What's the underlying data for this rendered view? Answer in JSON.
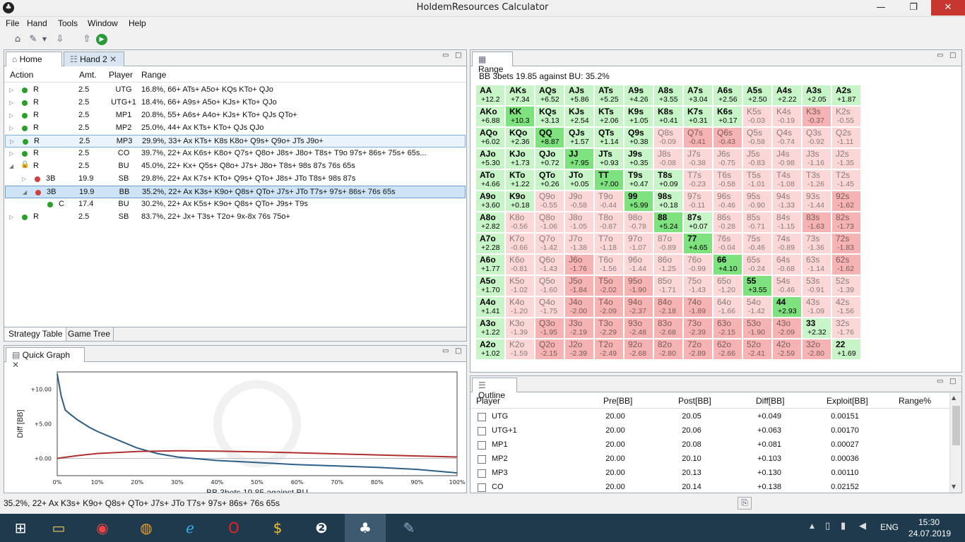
{
  "window": {
    "title": "HoldemResources Calculator",
    "icon": "club-icon",
    "min": "—",
    "max": "❐",
    "close": "✕"
  },
  "menu": [
    "File",
    "Hand",
    "Tools",
    "Window",
    "Help"
  ],
  "tabs": {
    "home": "Home",
    "hand": "Hand 2"
  },
  "tree": {
    "headers": {
      "action": "Action",
      "amt": "Amt.",
      "player": "Player",
      "range": "Range"
    },
    "rows": [
      {
        "action": "R",
        "amt": "2.5",
        "player": "UTG",
        "range": "16.8%, 66+ ATs+ A5o+ KQs KTo+ QJo"
      },
      {
        "action": "R",
        "amt": "2.5",
        "player": "UTG+1",
        "range": "18.4%, 66+ A9s+ A5o+ KJs+ KTo+ QJo"
      },
      {
        "action": "R",
        "amt": "2.5",
        "player": "MP1",
        "range": "20.8%, 55+ A6s+ A4o+ KJs+ KTo+ QJs QTo+"
      },
      {
        "action": "R",
        "amt": "2.5",
        "player": "MP2",
        "range": "25.0%, 44+ Ax KTs+ KTo+ QJs QJo"
      },
      {
        "action": "R",
        "amt": "2.5",
        "player": "MP3",
        "range": "29.9%, 33+ Ax KTs+ K8s K8o+ Q9s+ Q9o+ JTs J9o+"
      },
      {
        "action": "R",
        "amt": "2.5",
        "player": "CO",
        "range": "39.7%, 22+ Ax K6s+ K8o+ Q7s+ Q8o+ J8s+ J8o+ T8s+ T9o 97s+ 86s+ 75s+ 65s..."
      },
      {
        "action": "R",
        "amt": "2.5",
        "player": "BU",
        "range": "45.0%, 22+ Kx+ Q5s+ Q8o+ J7s+ J8o+ T8s+ 98s 87s 76s 65s"
      },
      {
        "action": "3B",
        "amt": "19.9",
        "player": "SB",
        "range": "29.8%, 22+ Ax K7s+ KTo+ Q9s+ QTo+ J8s+ JTo T8s+ 98s 87s"
      },
      {
        "action": "3B",
        "amt": "19.9",
        "player": "BB",
        "range": "35.2%, 22+ Ax K3s+ K9o+ Q8s+ QTo+ J7s+ JTo T7s+ 97s+ 86s+ 76s 65s"
      },
      {
        "action": "C",
        "amt": "17.4",
        "player": "BU",
        "range": "30.2%, 22+ Ax K5s+ K9o+ Q8s+ QTo+ J9s+ T9s"
      },
      {
        "action": "R",
        "amt": "2.5",
        "player": "SB",
        "range": "83.7%, 22+ Jx+ T3s+ T2o+ 9x-8x 76s 75o+"
      }
    ],
    "bottom_tabs": [
      "Strategy Table",
      "Game Tree"
    ]
  },
  "quick_graph": {
    "title": "Quick Graph",
    "ylabel": "Diff [BB]",
    "xlabel": "BB 3bets 19.85 against BU",
    "yticks": [
      "+10.00",
      "+5.00",
      "+0.00"
    ],
    "xticks": [
      "0%",
      "10%",
      "20%",
      "30%",
      "40%",
      "50%",
      "60%",
      "70%",
      "80%",
      "90%",
      "100%"
    ]
  },
  "chart_data": {
    "type": "line",
    "title": "",
    "xlabel": "BB 3bets 19.85 against BU",
    "ylabel": "Diff [BB]",
    "xlim": [
      0,
      100
    ],
    "ylim": [
      -2.5,
      12.5
    ],
    "series": [
      {
        "color": "#2e5f86",
        "x": [
          0,
          1,
          2,
          3,
          5,
          8,
          10,
          15,
          20,
          25,
          30,
          40,
          50,
          60,
          70,
          80,
          90,
          100
        ],
        "y": [
          12.2,
          9,
          7,
          6.5,
          5.6,
          4.5,
          3.9,
          2.7,
          1.5,
          0.7,
          0.2,
          -0.3,
          -0.6,
          -0.9,
          -1.1,
          -1.3,
          -1.6,
          -2.1
        ]
      },
      {
        "color": "#b03030",
        "x": [
          0,
          5,
          10,
          20,
          30,
          40,
          50,
          60,
          70,
          80,
          90,
          100
        ],
        "y": [
          0,
          0.4,
          0.7,
          1.0,
          1.1,
          1.05,
          0.95,
          0.8,
          0.65,
          0.5,
          0.35,
          0.2
        ]
      }
    ]
  },
  "range": {
    "title": "Range",
    "subtitle": "BB 3bets 19.85 against BU: 35.2%",
    "colors": {
      "green_strong": "#7ee27e",
      "green_light": "#c8f5c8",
      "red_light": "#fbd7d7",
      "red_mid": "#f6b3b3"
    },
    "rows": [
      [
        [
          "AA",
          "+12.2",
          "g"
        ],
        [
          "AKs",
          "+7.34",
          "g"
        ],
        [
          "AQs",
          "+6.52",
          "g"
        ],
        [
          "AJs",
          "+5.86",
          "g"
        ],
        [
          "ATs",
          "+5.25",
          "g"
        ],
        [
          "A9s",
          "+4.26",
          "g"
        ],
        [
          "A8s",
          "+3.55",
          "g"
        ],
        [
          "A7s",
          "+3.04",
          "g"
        ],
        [
          "A6s",
          "+2.56",
          "g"
        ],
        [
          "A5s",
          "+2.50",
          "g"
        ],
        [
          "A4s",
          "+2.22",
          "g"
        ],
        [
          "A3s",
          "+2.05",
          "g"
        ],
        [
          "A2s",
          "+1.87",
          "g"
        ]
      ],
      [
        [
          "AKo",
          "+6.88",
          "g"
        ],
        [
          "KK",
          "+10.3",
          "G"
        ],
        [
          "KQs",
          "+3.13",
          "g"
        ],
        [
          "KJs",
          "+2.54",
          "g"
        ],
        [
          "KTs",
          "+2.06",
          "g"
        ],
        [
          "K9s",
          "+1.05",
          "g"
        ],
        [
          "K8s",
          "+0.41",
          "g"
        ],
        [
          "K7s",
          "+0.31",
          "g"
        ],
        [
          "K6s",
          "+0.17",
          "g"
        ],
        [
          "K5s",
          "-0.03",
          "r"
        ],
        [
          "K4s",
          "-0.19",
          "r"
        ],
        [
          "K3s",
          "-0.37",
          "R"
        ],
        [
          "K2s",
          "-0.55",
          "r"
        ]
      ],
      [
        [
          "AQo",
          "+6.02",
          "g"
        ],
        [
          "KQo",
          "+2.36",
          "g"
        ],
        [
          "QQ",
          "+8.87",
          "G"
        ],
        [
          "QJs",
          "+1.57",
          "g"
        ],
        [
          "QTs",
          "+1.14",
          "g"
        ],
        [
          "Q9s",
          "+0.38",
          "g"
        ],
        [
          "Q8s",
          "-0.09",
          "r"
        ],
        [
          "Q7s",
          "-0.41",
          "R"
        ],
        [
          "Q6s",
          "-0.43",
          "R"
        ],
        [
          "Q5s",
          "-0.58",
          "r"
        ],
        [
          "Q4s",
          "-0.74",
          "r"
        ],
        [
          "Q3s",
          "-0.92",
          "r"
        ],
        [
          "Q2s",
          "-1.11",
          "r"
        ]
      ],
      [
        [
          "AJo",
          "+5.30",
          "g"
        ],
        [
          "KJo",
          "+1.73",
          "g"
        ],
        [
          "QJo",
          "+0.72",
          "g"
        ],
        [
          "JJ",
          "+7.95",
          "G"
        ],
        [
          "JTs",
          "+0.93",
          "g"
        ],
        [
          "J9s",
          "+0.35",
          "g"
        ],
        [
          "J8s",
          "-0.08",
          "r"
        ],
        [
          "J7s",
          "-0.38",
          "r"
        ],
        [
          "J6s",
          "-0.75",
          "r"
        ],
        [
          "J5s",
          "-0.83",
          "r"
        ],
        [
          "J4s",
          "-0.98",
          "r"
        ],
        [
          "J3s",
          "-1.16",
          "r"
        ],
        [
          "J2s",
          "-1.35",
          "r"
        ]
      ],
      [
        [
          "ATo",
          "+4.66",
          "g"
        ],
        [
          "KTo",
          "+1.22",
          "g"
        ],
        [
          "QTo",
          "+0.26",
          "g"
        ],
        [
          "JTo",
          "+0.05",
          "g"
        ],
        [
          "TT",
          "+7.00",
          "G"
        ],
        [
          "T9s",
          "+0.47",
          "g"
        ],
        [
          "T8s",
          "+0.09",
          "g"
        ],
        [
          "T7s",
          "-0.23",
          "r"
        ],
        [
          "T6s",
          "-0.58",
          "r"
        ],
        [
          "T5s",
          "-1.01",
          "r"
        ],
        [
          "T4s",
          "-1.08",
          "r"
        ],
        [
          "T3s",
          "-1.26",
          "r"
        ],
        [
          "T2s",
          "-1.45",
          "r"
        ]
      ],
      [
        [
          "A9o",
          "+3.60",
          "g"
        ],
        [
          "K9o",
          "+0.18",
          "g"
        ],
        [
          "Q9o",
          "-0.55",
          "r"
        ],
        [
          "J9o",
          "-0.58",
          "r"
        ],
        [
          "T9o",
          "-0.44",
          "r"
        ],
        [
          "99",
          "+5.99",
          "G"
        ],
        [
          "98s",
          "+0.18",
          "g"
        ],
        [
          "97s",
          "-0.11",
          "r"
        ],
        [
          "96s",
          "-0.46",
          "r"
        ],
        [
          "95s",
          "-0.90",
          "r"
        ],
        [
          "94s",
          "-1.33",
          "r"
        ],
        [
          "93s",
          "-1.44",
          "r"
        ],
        [
          "92s",
          "-1.62",
          "R"
        ]
      ],
      [
        [
          "A8o",
          "+2.82",
          "g"
        ],
        [
          "K8o",
          "-0.56",
          "r"
        ],
        [
          "Q8o",
          "-1.06",
          "r"
        ],
        [
          "J8o",
          "-1.05",
          "r"
        ],
        [
          "T8o",
          "-0.87",
          "r"
        ],
        [
          "98o",
          "-0.78",
          "r"
        ],
        [
          "88",
          "+5.24",
          "G"
        ],
        [
          "87s",
          "+0.07",
          "g"
        ],
        [
          "86s",
          "-0.28",
          "r"
        ],
        [
          "85s",
          "-0.71",
          "r"
        ],
        [
          "84s",
          "-1.15",
          "r"
        ],
        [
          "83s",
          "-1.63",
          "R"
        ],
        [
          "82s",
          "-1.73",
          "R"
        ]
      ],
      [
        [
          "A7o",
          "+2.28",
          "g"
        ],
        [
          "K7o",
          "-0.66",
          "r"
        ],
        [
          "Q7o",
          "-1.42",
          "r"
        ],
        [
          "J7o",
          "-1.38",
          "r"
        ],
        [
          "T7o",
          "-1.18",
          "r"
        ],
        [
          "97o",
          "-1.07",
          "r"
        ],
        [
          "87o",
          "-0.89",
          "r"
        ],
        [
          "77",
          "+4.65",
          "G"
        ],
        [
          "76s",
          "-0.04",
          "r"
        ],
        [
          "75s",
          "-0.46",
          "r"
        ],
        [
          "74s",
          "-0.89",
          "r"
        ],
        [
          "73s",
          "-1.36",
          "r"
        ],
        [
          "72s",
          "-1.83",
          "R"
        ]
      ],
      [
        [
          "A6o",
          "+1.77",
          "g"
        ],
        [
          "K6o",
          "-0.81",
          "r"
        ],
        [
          "Q6o",
          "-1.43",
          "r"
        ],
        [
          "J6o",
          "-1.76",
          "R"
        ],
        [
          "T6o",
          "-1.56",
          "r"
        ],
        [
          "96o",
          "-1.44",
          "r"
        ],
        [
          "86o",
          "-1.25",
          "r"
        ],
        [
          "76o",
          "-0.99",
          "r"
        ],
        [
          "66",
          "+4.10",
          "G"
        ],
        [
          "65s",
          "-0.24",
          "r"
        ],
        [
          "64s",
          "-0.68",
          "r"
        ],
        [
          "63s",
          "-1.14",
          "r"
        ],
        [
          "62s",
          "-1.62",
          "R"
        ]
      ],
      [
        [
          "A5o",
          "+1.70",
          "g"
        ],
        [
          "K5o",
          "-1.02",
          "r"
        ],
        [
          "Q5o",
          "-1.60",
          "r"
        ],
        [
          "J5o",
          "-1.84",
          "R"
        ],
        [
          "T5o",
          "-2.02",
          "R"
        ],
        [
          "95o",
          "-1.90",
          "R"
        ],
        [
          "85o",
          "-1.71",
          "r"
        ],
        [
          "75o",
          "-1.43",
          "r"
        ],
        [
          "65o",
          "-1.20",
          "r"
        ],
        [
          "55",
          "+3.55",
          "G"
        ],
        [
          "54s",
          "-0.46",
          "r"
        ],
        [
          "53s",
          "-0.91",
          "r"
        ],
        [
          "52s",
          "-1.39",
          "r"
        ]
      ],
      [
        [
          "A4o",
          "+1.41",
          "g"
        ],
        [
          "K4o",
          "-1.20",
          "r"
        ],
        [
          "Q4o",
          "-1.75",
          "r"
        ],
        [
          "J4o",
          "-2.00",
          "R"
        ],
        [
          "T4o",
          "-2.09",
          "R"
        ],
        [
          "94o",
          "-2.37",
          "R"
        ],
        [
          "84o",
          "-2.18",
          "R"
        ],
        [
          "74o",
          "-1.89",
          "R"
        ],
        [
          "64o",
          "-1.66",
          "r"
        ],
        [
          "54o",
          "-1.42",
          "r"
        ],
        [
          "44",
          "+2.93",
          "G"
        ],
        [
          "43s",
          "-1.09",
          "r"
        ],
        [
          "42s",
          "-1.56",
          "r"
        ]
      ],
      [
        [
          "A3o",
          "+1.22",
          "g"
        ],
        [
          "K3o",
          "-1.39",
          "r"
        ],
        [
          "Q3o",
          "-1.95",
          "R"
        ],
        [
          "J3o",
          "-2.19",
          "R"
        ],
        [
          "T3o",
          "-2.29",
          "R"
        ],
        [
          "93o",
          "-2.48",
          "R"
        ],
        [
          "83o",
          "-2.68",
          "R"
        ],
        [
          "73o",
          "-2.39",
          "R"
        ],
        [
          "63o",
          "-2.15",
          "R"
        ],
        [
          "53o",
          "-1.90",
          "R"
        ],
        [
          "43o",
          "-2.09",
          "R"
        ],
        [
          "33",
          "+2.32",
          "g"
        ],
        [
          "32s",
          "-1.76",
          "r"
        ]
      ],
      [
        [
          "A2o",
          "+1.02",
          "g"
        ],
        [
          "K2o",
          "-1.59",
          "r"
        ],
        [
          "Q2o",
          "-2.15",
          "R"
        ],
        [
          "J2o",
          "-2.39",
          "R"
        ],
        [
          "T2o",
          "-2.49",
          "R"
        ],
        [
          "92o",
          "-2.68",
          "R"
        ],
        [
          "82o",
          "-2.80",
          "R"
        ],
        [
          "72o",
          "-2.89",
          "R"
        ],
        [
          "62o",
          "-2.66",
          "R"
        ],
        [
          "52o",
          "-2.41",
          "R"
        ],
        [
          "42o",
          "-2.59",
          "R"
        ],
        [
          "32o",
          "-2.80",
          "R"
        ],
        [
          "22",
          "+1.69",
          "g"
        ]
      ]
    ]
  },
  "outline": {
    "title": "Outline",
    "headers": [
      "Player",
      "Pre[BB]",
      "Post[BB]",
      "Diff[BB]",
      "Exploit[BB]",
      "Range%"
    ],
    "rows": [
      [
        "UTG",
        "20.00",
        "20.05",
        "+0.049",
        "0.00151"
      ],
      [
        "UTG+1",
        "20.00",
        "20.06",
        "+0.063",
        "0.00170"
      ],
      [
        "MP1",
        "20.00",
        "20.08",
        "+0.081",
        "0.00027"
      ],
      [
        "MP2",
        "20.00",
        "20.10",
        "+0.103",
        "0.00036"
      ],
      [
        "MP3",
        "20.00",
        "20.13",
        "+0.130",
        "0.00110"
      ],
      [
        "CO",
        "20.00",
        "20.14",
        "+0.138",
        "0.02152"
      ]
    ]
  },
  "statusbar": {
    "text": "35.2%, 22+ Ax K3s+ K9o+ Q8s+ QTo+ J7s+ JTo T7s+ 97s+ 86s+ 76s 65s"
  },
  "taskbar": {
    "lang": "ENG",
    "time": "15:30",
    "date": "24.07.2019"
  }
}
